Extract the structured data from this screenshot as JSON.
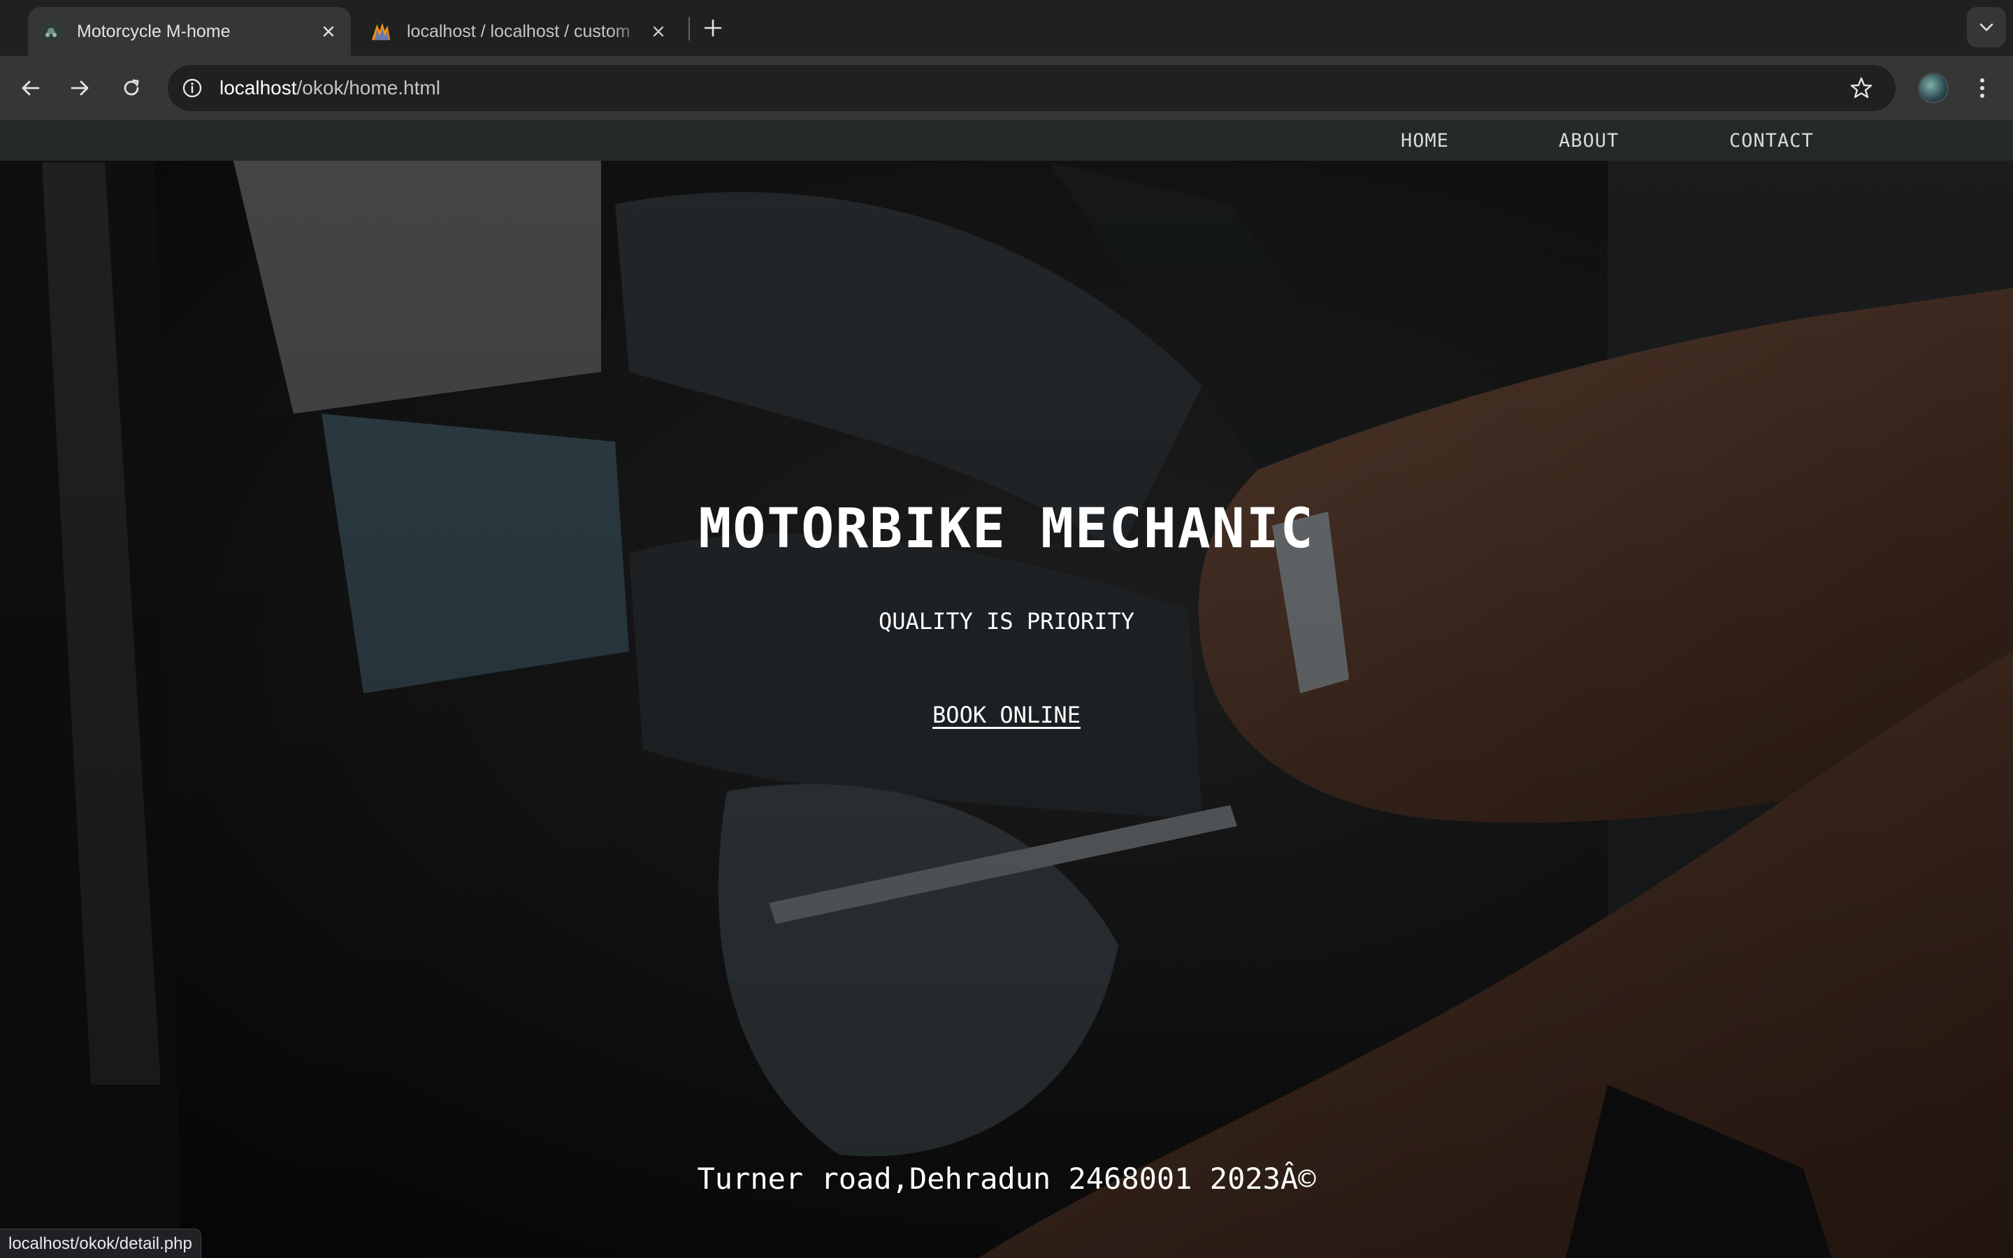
{
  "browser": {
    "tabs": [
      {
        "title": "Motorcycle M-home",
        "icon": "motorcycle-favicon-icon",
        "active": true
      },
      {
        "title": "localhost / localhost / custom",
        "icon": "phpmyadmin-favicon-icon",
        "active": false
      }
    ],
    "address": {
      "host": "localhost",
      "path": "/okok/home.html"
    },
    "status_url": "localhost/okok/detail.php"
  },
  "site": {
    "nav": {
      "home": "HOME",
      "about": "ABOUT",
      "contact": "CONTACT"
    },
    "hero": {
      "title": "MOTORBIKE MECHANIC",
      "subtitle": "QUALITY IS PRIORITY",
      "cta": "BOOK ONLINE"
    },
    "footer": "Turner road,Dehradun 2468001 2023Â©"
  },
  "colors": {
    "chrome_bg": "#1f2020",
    "toolbar_bg": "#353636",
    "site_nav_bg": "#25292a",
    "hero_text": "#ffffff"
  }
}
